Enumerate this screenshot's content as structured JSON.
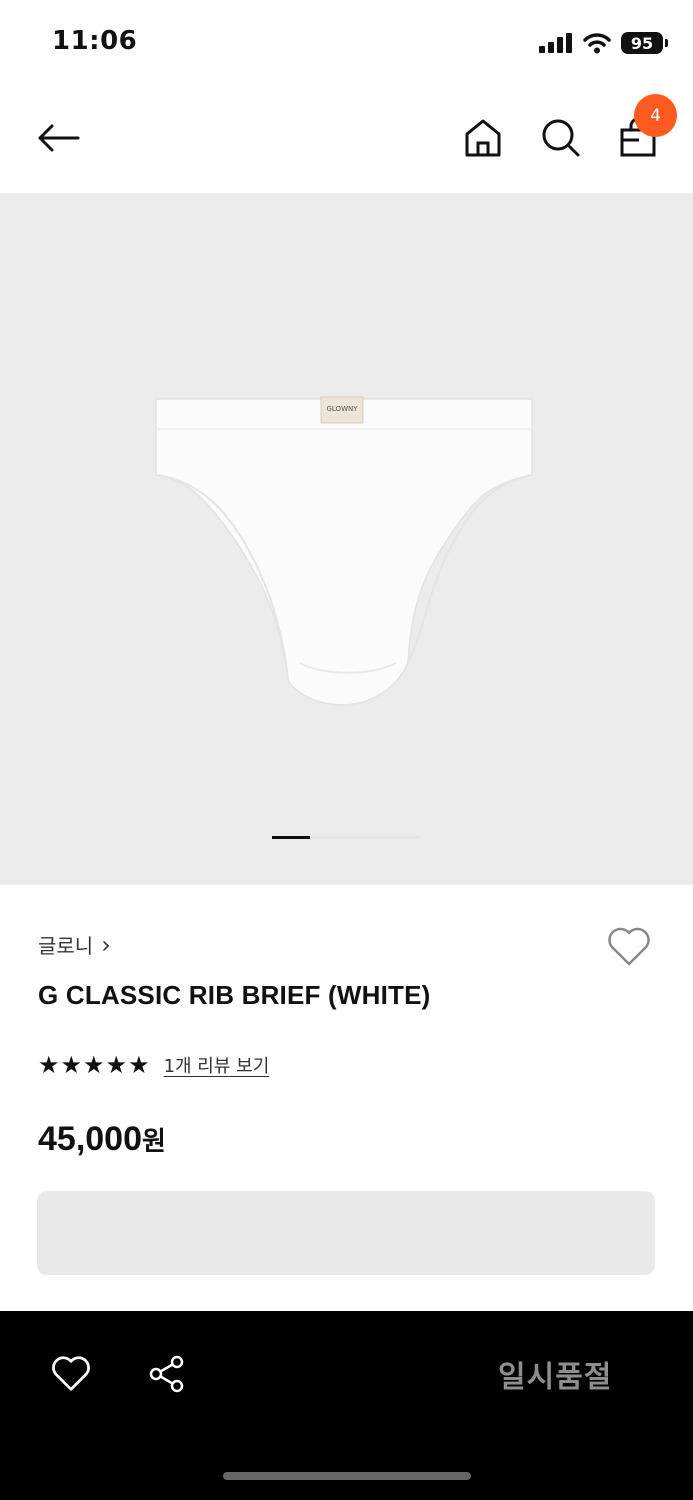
{
  "status_bar": {
    "time": "11:06",
    "battery": "95"
  },
  "header": {
    "cart_count": "4"
  },
  "product": {
    "image_label": "GLOWNY",
    "brand": "글로니",
    "brand_chevron": "›",
    "name": "G CLASSIC RIB BRIEF (WHITE)",
    "rating_stars": 5,
    "star_glyph": "★",
    "review_link": "1개 리뷰 보기",
    "price_value": "45,000",
    "price_unit": "원",
    "gallery_page": 1
  },
  "bottom_bar": {
    "cta_label": "일시품절"
  },
  "colors": {
    "accent_badge": "#ff5a1f",
    "gallery_bg": "#ebebeb",
    "bottom_bar_bg": "#000000"
  }
}
